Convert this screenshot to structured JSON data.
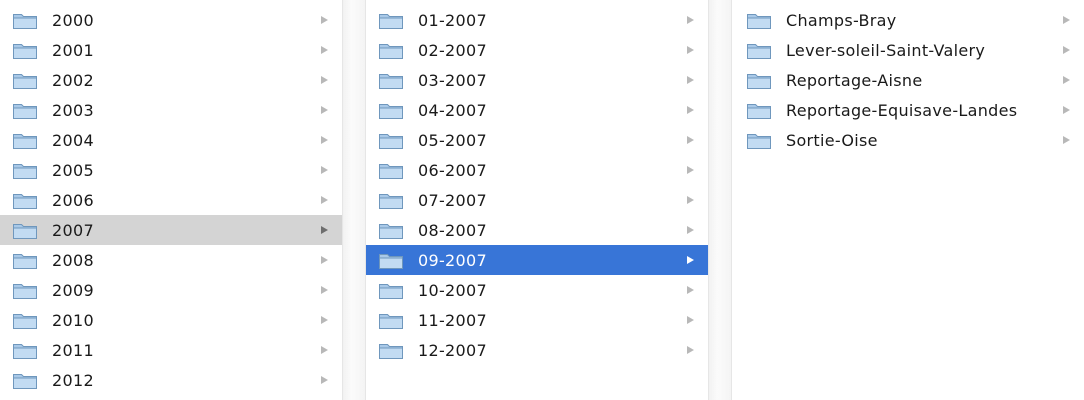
{
  "years": [
    {
      "label": "2000",
      "icon": "folder-icon",
      "selected": false
    },
    {
      "label": "2001",
      "icon": "folder-icon",
      "selected": false
    },
    {
      "label": "2002",
      "icon": "folder-icon",
      "selected": false
    },
    {
      "label": "2003",
      "icon": "folder-icon",
      "selected": false
    },
    {
      "label": "2004",
      "icon": "folder-icon",
      "selected": false
    },
    {
      "label": "2005",
      "icon": "folder-icon",
      "selected": false
    },
    {
      "label": "2006",
      "icon": "folder-icon",
      "selected": false
    },
    {
      "label": "2007",
      "icon": "folder-icon",
      "selected": true
    },
    {
      "label": "2008",
      "icon": "folder-icon",
      "selected": false
    },
    {
      "label": "2009",
      "icon": "folder-icon",
      "selected": false
    },
    {
      "label": "2010",
      "icon": "folder-icon",
      "selected": false
    },
    {
      "label": "2011",
      "icon": "folder-icon",
      "selected": false
    },
    {
      "label": "2012",
      "icon": "folder-icon",
      "selected": false
    }
  ],
  "months": [
    {
      "label": "01-2007",
      "icon": "folder-icon",
      "selected": false
    },
    {
      "label": "02-2007",
      "icon": "folder-icon",
      "selected": false
    },
    {
      "label": "03-2007",
      "icon": "folder-icon",
      "selected": false
    },
    {
      "label": "04-2007",
      "icon": "folder-icon",
      "selected": false
    },
    {
      "label": "05-2007",
      "icon": "folder-icon",
      "selected": false
    },
    {
      "label": "06-2007",
      "icon": "folder-icon",
      "selected": false
    },
    {
      "label": "07-2007",
      "icon": "folder-icon",
      "selected": false
    },
    {
      "label": "08-2007",
      "icon": "folder-icon",
      "selected": false
    },
    {
      "label": "09-2007",
      "icon": "folder-icon",
      "selected": true
    },
    {
      "label": "10-2007",
      "icon": "folder-icon",
      "selected": false
    },
    {
      "label": "11-2007",
      "icon": "folder-icon",
      "selected": false
    },
    {
      "label": "12-2007",
      "icon": "folder-icon",
      "selected": false
    }
  ],
  "folders": [
    {
      "label": "Champs-Bray",
      "icon": "folder-icon",
      "selected": false
    },
    {
      "label": "Lever-soleil-Saint-Valery",
      "icon": "folder-icon",
      "selected": false
    },
    {
      "label": "Reportage-Aisne",
      "icon": "folder-icon",
      "selected": false
    },
    {
      "label": "Reportage-Equisave-Landes",
      "icon": "folder-icon",
      "selected": false
    },
    {
      "label": "Sortie-Oise",
      "icon": "folder-icon",
      "selected": false
    }
  ],
  "colors": {
    "selection_active": "#3875d7",
    "selection_inactive": "#d4d4d4",
    "folder_fill": "#a9c9e8",
    "folder_stroke": "#6f97bd"
  }
}
